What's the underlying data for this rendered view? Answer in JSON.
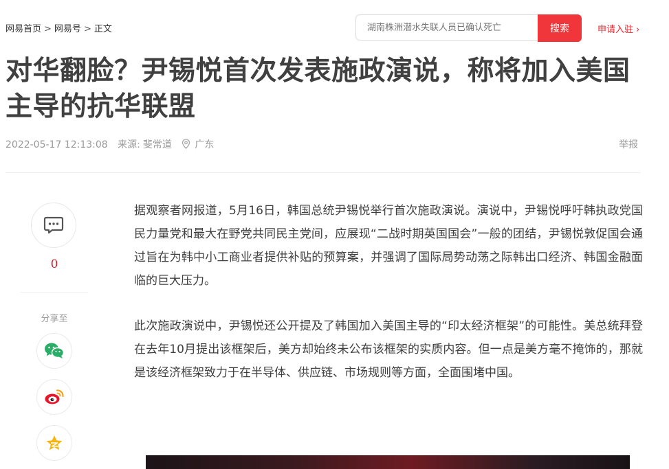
{
  "breadcrumb": {
    "home": "网易首页",
    "section": "网易号",
    "current": "正文",
    "sep": ">"
  },
  "search": {
    "placeholder": "湖南株洲潜水失联人员已确认死亡",
    "button_label": "搜索"
  },
  "join_link": "申请入驻",
  "article": {
    "title": "对华翻脸？尹锡悦首次发表施政演说，称将加入美国主导的抗华联盟",
    "datetime": "2022-05-17 12:13:08",
    "source_label": "来源:",
    "source_name": "斐常道",
    "location": "广东",
    "report_label": "举报",
    "paragraphs": [
      "据观察者网报道，5月16日，韩国总统尹锡悦举行首次施政演说。演说中，尹锡悦呼吁韩执政党国民力量党和最大在野党共同民主党间，应展现“二战时期英国国会”一般的团结，尹锡悦敦促国会通过旨在为韩中小工商业者提供补贴的预算案，并强调了国际局势动荡之际韩出口经济、韩国金融面临的巨大压力。",
      "此次施政演说中，尹锡悦还公开提及了韩国加入美国主导的“印太经济框架”的可能性。美总统拜登在去年10月提出该框架后，美方却始终未公布该框架的实质内容。但一点是美方毫不掩饰的，那就是该经济框架致力于在半导体、供应链、市场规则等方面，全面围堵中国。"
    ]
  },
  "sidebar": {
    "comment_count": "0",
    "share_label": "分享至",
    "share_targets": [
      "wechat-icon",
      "weibo-icon",
      "qzone-icon"
    ]
  },
  "colors": {
    "accent": "#f0363a",
    "link_red": "#e6262e",
    "count_red": "#cc1f27",
    "wechat_green": "#2aae67",
    "weibo_red": "#e6162d",
    "qzone_yellow": "#f6b40e"
  }
}
